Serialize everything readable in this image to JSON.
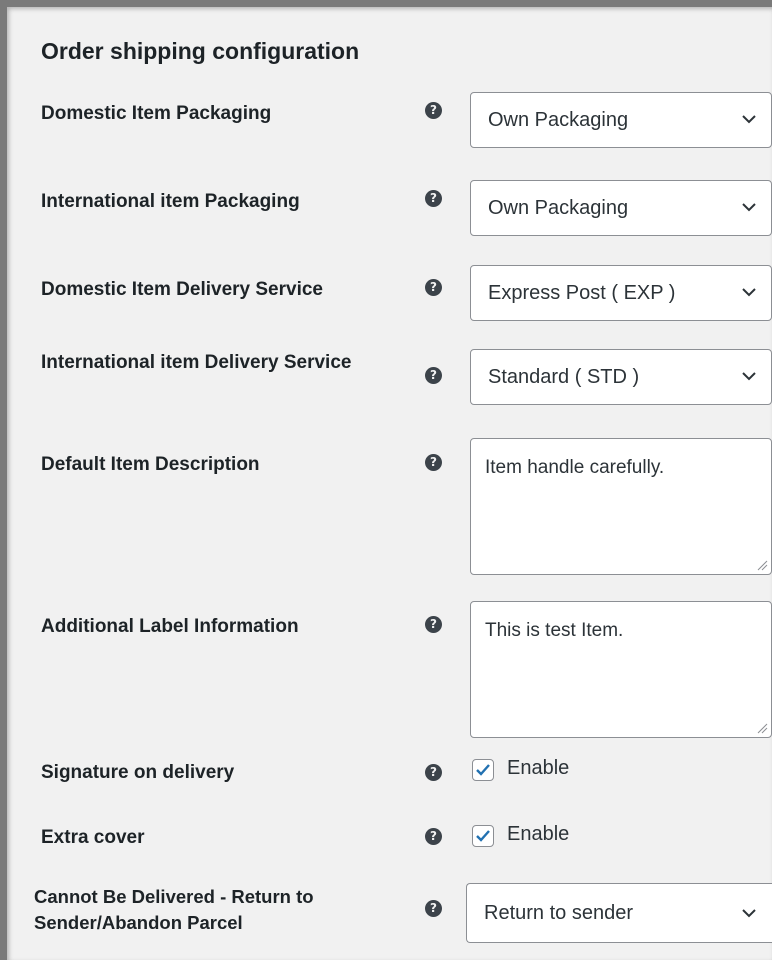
{
  "section": {
    "title": "Order shipping configuration"
  },
  "help_icon_glyph": "?",
  "fields": {
    "domestic_packaging": {
      "label": "Domestic Item Packaging",
      "value": "Own Packaging"
    },
    "international_packaging": {
      "label": "International item Packaging",
      "value": "Own Packaging"
    },
    "domestic_delivery_service": {
      "label": "Domestic Item Delivery Service",
      "value": "Express Post ( EXP )"
    },
    "international_delivery_service": {
      "label": "International item Delivery Service",
      "value": "Standard ( STD )"
    },
    "default_item_description": {
      "label": "Default Item Description",
      "value": "Item handle carefully."
    },
    "additional_label_information": {
      "label": "Additional Label Information",
      "value": "This is test Item."
    },
    "signature_on_delivery": {
      "label": "Signature on delivery",
      "checked": true,
      "option_label": "Enable"
    },
    "extra_cover": {
      "label": "Extra cover",
      "checked": true,
      "option_label": "Enable"
    },
    "undeliverable_action": {
      "label": "Cannot Be Delivered - Return to Sender/Abandon Parcel",
      "value": "Return to sender"
    }
  },
  "colors": {
    "accent": "#2271b1",
    "text": "#1d2327",
    "border": "#8c8f94",
    "background": "#f1f1f1"
  },
  "icons": {
    "help": "question-circle-icon",
    "dropdown": "chevron-down-icon",
    "resize": "resize-grip-icon",
    "check": "checkmark-icon"
  }
}
